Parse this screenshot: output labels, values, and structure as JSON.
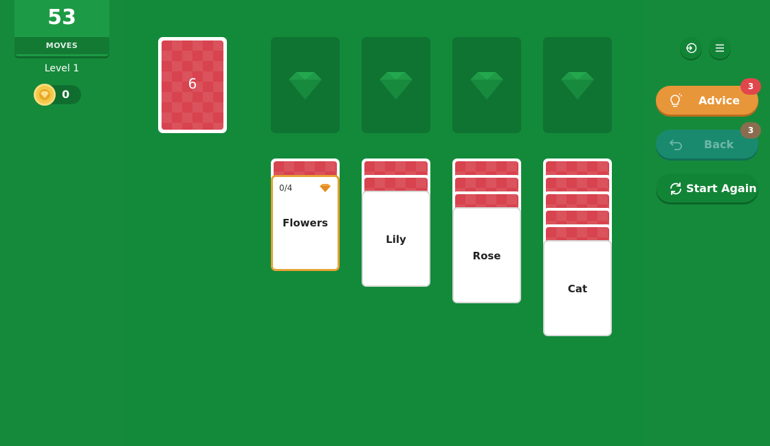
{
  "stats": {
    "moves": "53",
    "moves_label": "MOVES",
    "level": "Level 1",
    "coins": "0"
  },
  "stock": {
    "count": "6"
  },
  "foundations": [
    {
      "icon": "gem-icon"
    },
    {
      "icon": "gem-icon"
    },
    {
      "icon": "gem-icon"
    },
    {
      "icon": "gem-icon"
    }
  ],
  "tableau": [
    {
      "label": "Flowers",
      "progress": "0/4",
      "hidden_cards": 1,
      "category_card": true
    },
    {
      "label": "Lily",
      "hidden_cards": 2
    },
    {
      "label": "Rose",
      "hidden_cards": 3
    },
    {
      "label": "Cat",
      "hidden_cards": 5
    }
  ],
  "buttons": {
    "advice": {
      "label": "Advice",
      "badge": "3"
    },
    "back": {
      "label": "Back",
      "badge": "3"
    },
    "restart": {
      "label": "Start Again"
    }
  },
  "colors": {
    "table": "#128a3a",
    "card_back": "#d7434e",
    "advice": "#e8963a",
    "highlight": "#e6a235"
  }
}
